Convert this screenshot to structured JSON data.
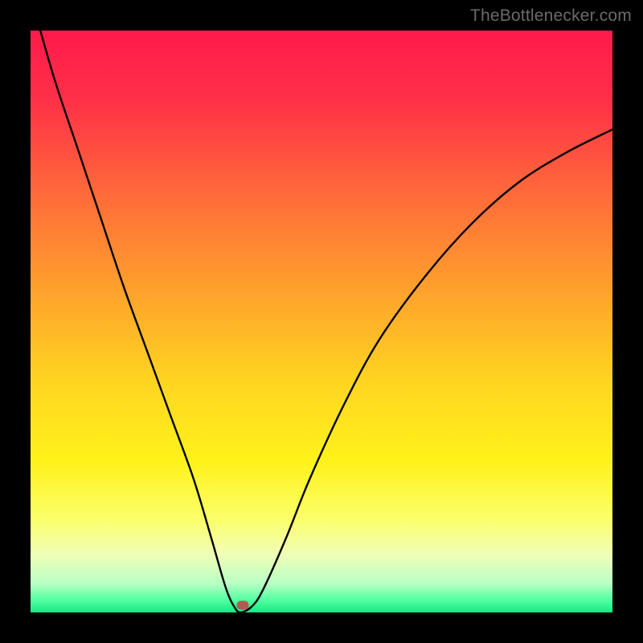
{
  "watermark": {
    "text": "TheBottlenecker.com"
  },
  "chart_data": {
    "type": "line",
    "title": "",
    "xlabel": "",
    "ylabel": "",
    "xlim": [
      0,
      100
    ],
    "ylim": [
      0,
      100
    ],
    "bottleneck_point_x": 36,
    "gradient_stops": [
      {
        "pct": 0,
        "color": "#ff1a4b"
      },
      {
        "pct": 12,
        "color": "#ff3047"
      },
      {
        "pct": 28,
        "color": "#ff6a3a"
      },
      {
        "pct": 44,
        "color": "#ff9f2d"
      },
      {
        "pct": 60,
        "color": "#ffd421"
      },
      {
        "pct": 74,
        "color": "#fff21a"
      },
      {
        "pct": 84,
        "color": "#fbff6a"
      },
      {
        "pct": 90,
        "color": "#f0ffb8"
      },
      {
        "pct": 95,
        "color": "#b9ffc4"
      },
      {
        "pct": 98,
        "color": "#4effa0"
      },
      {
        "pct": 100,
        "color": "#17e884"
      }
    ],
    "series": [
      {
        "name": "bottleneck-curve",
        "x": [
          0,
          4,
          8,
          12,
          16,
          20,
          24,
          28,
          31,
          33,
          34,
          35,
          36,
          38,
          40,
          44,
          48,
          54,
          60,
          68,
          76,
          84,
          92,
          100
        ],
        "y": [
          106,
          92,
          80,
          68,
          56,
          45,
          34,
          23,
          13,
          6,
          3,
          1,
          0,
          1,
          4,
          13,
          23,
          36,
          47,
          58,
          67,
          74,
          79,
          83
        ]
      }
    ],
    "marker": {
      "x": 36.5,
      "y": 1.3,
      "color": "#b15a52"
    }
  }
}
